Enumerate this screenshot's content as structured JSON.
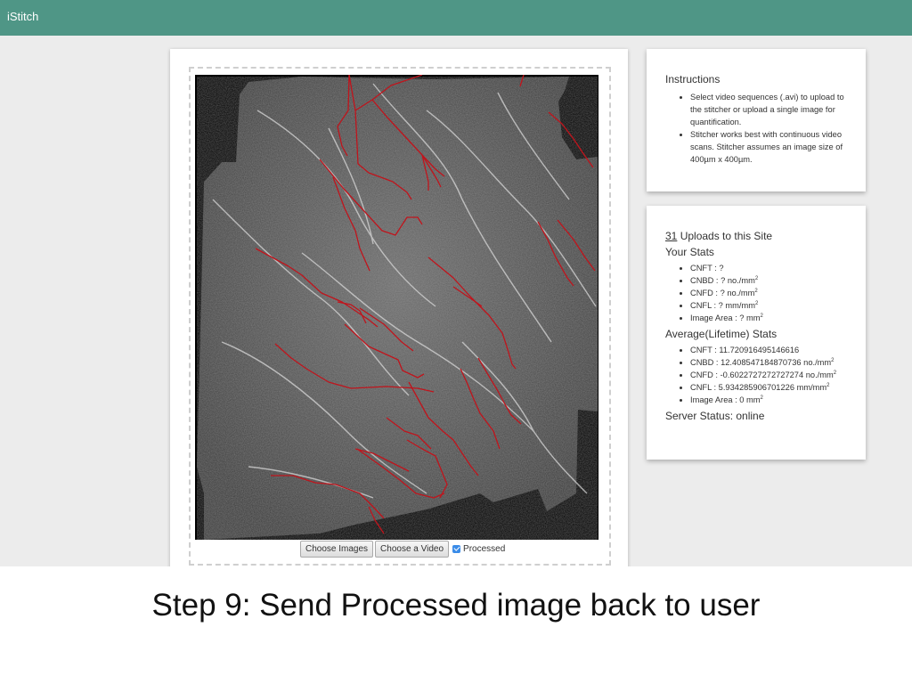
{
  "app": {
    "brand": "iStitch"
  },
  "uploader": {
    "choose_images_label": "Choose Images",
    "choose_video_label": "Choose a Video",
    "processed_label": "Processed",
    "processed_checked": true
  },
  "instructions": {
    "heading": "Instructions",
    "items": [
      "Select video sequences (.avi) to upload to the stitcher or upload a single image for quantification.",
      "Stitcher works best with continuous video scans. Stitcher assumes an image size of 400µm x 400µm."
    ]
  },
  "stats": {
    "uploads_count": "31",
    "uploads_text": " Uploads to this Site",
    "your_heading": "Your Stats",
    "your": [
      {
        "label": "CNFT : ?",
        "sup": ""
      },
      {
        "label": "CNBD : ? no./mm",
        "sup": "2"
      },
      {
        "label": "CNFD : ? no./mm",
        "sup": "2"
      },
      {
        "label": "CNFL : ? mm/mm",
        "sup": "2"
      },
      {
        "label": "Image Area : ? mm",
        "sup": "2"
      }
    ],
    "avg_heading": "Average(Lifetime) Stats",
    "avg": [
      {
        "label": "CNFT : 11.720916495146616",
        "sup": ""
      },
      {
        "label": "CNBD : 12.408547184870736 no./mm",
        "sup": "2"
      },
      {
        "label": "CNFD : -0.6022727272727274 no./mm",
        "sup": "2"
      },
      {
        "label": "CNFL : 5.934285906701226 mm/mm",
        "sup": "2"
      },
      {
        "label": "Image Area : 0 mm",
        "sup": "2"
      }
    ],
    "server_status": "Server Status: online"
  },
  "caption": "Step 9: Send Processed image back to user",
  "colors": {
    "navbar": "#4f9686",
    "trace": "#c0141c",
    "checkbox": "#3b8ce8"
  }
}
